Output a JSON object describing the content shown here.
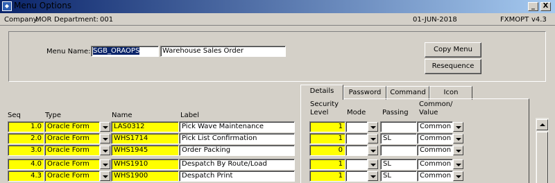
{
  "window": {
    "title": "Menu Options",
    "minimize": "_",
    "close": "X"
  },
  "status": {
    "company_label": "Company:",
    "company": "MOR",
    "department_label": "Department:",
    "department": "001",
    "date": "01-JUN-2018",
    "form_code": "FXMOPT",
    "version": "v4.3"
  },
  "menu": {
    "name_label": "Menu Name:",
    "name": "SGB_ORAOPS",
    "description": "Warehouse Sales Order",
    "copy_button": "Copy Menu",
    "resequence_button": "Resequence"
  },
  "tabs": [
    {
      "label": "Details",
      "active": true
    },
    {
      "label": "Password",
      "active": false
    },
    {
      "label": "Command",
      "active": false
    },
    {
      "label": "Icon",
      "active": false
    }
  ],
  "columns": {
    "seq": "Seq",
    "type": "Type",
    "name": "Name",
    "label": "Label",
    "security_line1": "Security",
    "security_line2": "Level",
    "mode": "Mode",
    "passing": "Passing",
    "common_line1": "Common/",
    "common_line2": "Value"
  },
  "rows": [
    {
      "seq": "1.0",
      "type": "Oracle Form",
      "name": "LAS0312",
      "label": "Pick Wave Maintenance",
      "security": "1",
      "mode": "",
      "passing": "",
      "common": "Common"
    },
    {
      "seq": "2.0",
      "type": "Oracle Form",
      "name": "WHS1714",
      "label": "Pick List Confirmation",
      "security": "1",
      "mode": "",
      "passing": "SL",
      "common": "Common"
    },
    {
      "seq": "3.0",
      "type": "Oracle Form",
      "name": "WHS1945",
      "label": "Order Packing",
      "security": "0",
      "mode": "",
      "passing": "",
      "common": "Common"
    },
    {
      "seq": "4.0",
      "type": "Oracle Form",
      "name": "WHS1910",
      "label": "Despatch By Route/Load",
      "security": "1",
      "mode": "",
      "passing": "SL",
      "common": "Common"
    },
    {
      "seq": "4.3",
      "type": "Oracle Form",
      "name": "WHS1900",
      "label": "Despatch Print",
      "security": "1",
      "mode": "",
      "passing": "SL",
      "common": "Common"
    }
  ]
}
